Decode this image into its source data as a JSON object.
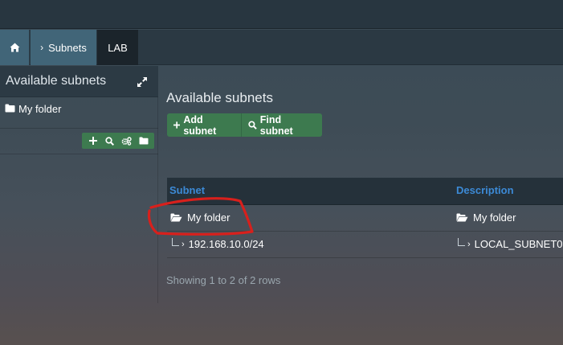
{
  "breadcrumb": {
    "home_icon": "home-icon",
    "subnets_label": "Subnets",
    "chevron": "›",
    "lab_label": "LAB"
  },
  "left_panel": {
    "title": "Available subnets",
    "tree": [
      {
        "label": "My folder",
        "icon": "folder-icon"
      }
    ],
    "tools": [
      "add-icon",
      "search-icon",
      "cogs-icon",
      "folder-icon"
    ]
  },
  "main": {
    "title": "Available subnets",
    "add_button": "Add subnet",
    "find_button": "Find subnet",
    "table": {
      "columns": [
        "Subnet",
        "Description"
      ],
      "rows": [
        {
          "subnet": "My folder",
          "description": "My folder",
          "type": "folder"
        },
        {
          "subnet": "192.168.10.0/24",
          "description": "LOCAL_SUBNET0",
          "type": "subnet"
        }
      ]
    },
    "footer": "Showing 1 to 2 of 2 rows"
  },
  "colors": {
    "accent_green": "#3d7a4f",
    "header_link_blue": "#3c8ad6",
    "annotation_red": "#d8201c"
  }
}
